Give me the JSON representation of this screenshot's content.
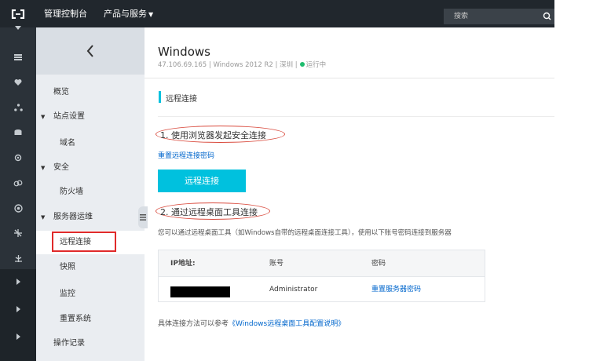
{
  "topbar": {
    "title": "管理控制台",
    "products_label": "产品与服务",
    "search_placeholder": "搜索",
    "logo": "[-]"
  },
  "sidebar": {
    "items": [
      {
        "label": "概览"
      },
      {
        "label": "站点设置"
      },
      {
        "label": "域名"
      },
      {
        "label": "安全"
      },
      {
        "label": "防火墙"
      },
      {
        "label": "服务器运维"
      },
      {
        "label": "远程连接"
      },
      {
        "label": "快照"
      },
      {
        "label": "监控"
      },
      {
        "label": "重置系统"
      },
      {
        "label": "操作记录"
      }
    ]
  },
  "main": {
    "title": "Windows",
    "ip": "47.106.69.165",
    "os": "Windows 2012 R2",
    "region": "深圳",
    "status": "运行中",
    "section_title": "远程连接",
    "step1_title": "1. 使用浏览器发起安全连接",
    "reset_link": "重置远程连接密码",
    "connect_button": "远程连接",
    "step2_title": "2. 通过远程桌面工具连接",
    "step2_desc": "您可以通过远程桌面工具（如Windows自带的远程桌面连接工具），使用以下账号密码连接到服务器",
    "table": {
      "headers": [
        "IP地址:",
        "账号",
        "密码"
      ],
      "account": "Administrator",
      "password_link": "重置服务器密码"
    },
    "footer_prefix": "具体连接方法可以参考",
    "footer_link": "《Windows远程桌面工具配置说明》"
  },
  "colors": {
    "accent": "#00c1de",
    "link": "#0066cc",
    "topbar": "#21272d",
    "status_green": "#1fbc6e",
    "highlight_red": "#e02a2a"
  }
}
